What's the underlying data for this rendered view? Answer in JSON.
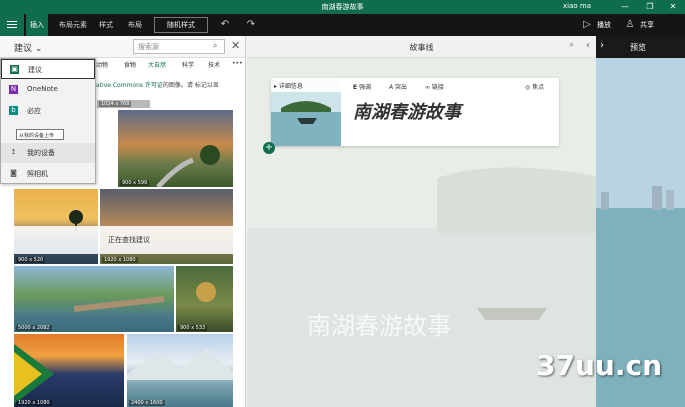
{
  "window": {
    "title": "南湖春游故事",
    "user": "xiao ma",
    "controls": [
      "—",
      "❐",
      "✕"
    ]
  },
  "ribbon": {
    "tabs": [
      "插入",
      "布局元素",
      "样式",
      "布局"
    ],
    "theme_button": "随机样式",
    "play_label": "播放",
    "share_label": "共享"
  },
  "left_panel": {
    "source_label": "建议",
    "search_placeholder": "搜索源",
    "categories": [
      "动物",
      "食物",
      "大自然",
      "科学",
      "技术"
    ],
    "active_category": "大自然",
    "license_link": "ative Commons 许可证",
    "license_text": "的图像。请 ",
    "license_rest": "标记以显",
    "menu": [
      {
        "label": "建议",
        "icon": "suggest-icon",
        "color": "#0f6c4f"
      },
      {
        "label": "OneNote",
        "icon": "onenote-icon",
        "color": "#7a2ba8"
      },
      {
        "label": "必应",
        "icon": "bing-icon",
        "color": "#0a8a7e"
      },
      {
        "label": "我的设备",
        "icon": "upload-icon",
        "color": "#555555"
      },
      {
        "label": "照相机",
        "icon": "camera-icon",
        "color": "#555555"
      }
    ],
    "tooltip": "从我的设备上传",
    "loading_text": "正在查找建议",
    "photos": [
      {
        "caption": "1024 x 768"
      },
      {
        "caption": "900 x 599"
      },
      {
        "caption": "900 x 520"
      },
      {
        "caption": "1920 x 1080"
      },
      {
        "caption": "5000 x 2082"
      },
      {
        "caption": "900 x 533"
      },
      {
        "caption": "1920 x 1080"
      },
      {
        "caption": "2400 x 1600"
      }
    ]
  },
  "storyline": {
    "header": "故事线",
    "card": {
      "details_label": "详细信息",
      "tools": [
        "强调",
        "突出",
        "链接",
        "焦点"
      ],
      "title": "南湖春游故事"
    },
    "watermark": "南湖春游故事"
  },
  "preview": {
    "header": "预览",
    "brand": "37uu.cn"
  },
  "colors": {
    "accent": "#0f6c4f",
    "ribbon": "#151515"
  }
}
